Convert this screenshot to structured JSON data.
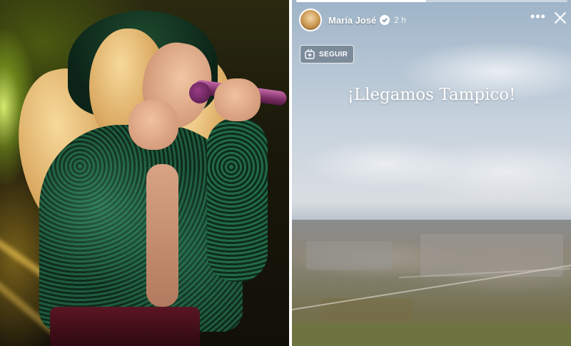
{
  "story": {
    "username": "María José",
    "timestamp": "2 h",
    "follow_label": "SEGUIR",
    "caption": "¡Llegamos Tampico!",
    "progress": 0.48
  },
  "icons": {
    "verified": "verified-badge-icon",
    "more": "more-options-icon",
    "close": "close-icon",
    "follow": "follow-icon"
  },
  "colors": {
    "divider": "#ffffff",
    "text": "#ffffff"
  }
}
